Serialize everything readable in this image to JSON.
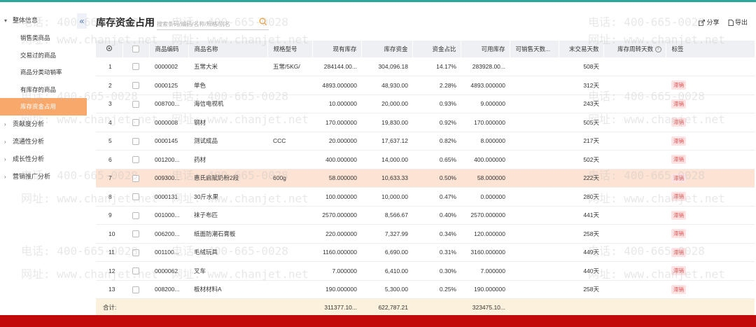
{
  "sidebar": {
    "groups": [
      {
        "label": "整体信息",
        "caret": "▾"
      },
      {
        "label": "贡献度分析",
        "caret": "›"
      },
      {
        "label": "流通性分析",
        "caret": "›"
      },
      {
        "label": "成长性分析",
        "caret": "›"
      },
      {
        "label": "营销推广分析",
        "caret": "›"
      }
    ],
    "subitems": [
      "销售类商品",
      "交易过的商品",
      "商品分类动销率",
      "有库存的商品",
      "库存资金占用"
    ],
    "collapse": "«"
  },
  "page_title": "库存资金占用",
  "search": {
    "placeholder": "搜索条码/编码/名称/规格/别名"
  },
  "toolbar": {
    "share": "分享",
    "export": "导出"
  },
  "table": {
    "headers": [
      "商品编码",
      "商品名称",
      "规格型号",
      "现有库存",
      "库存资金",
      "资金占比",
      "可用库存",
      "可销售天数...",
      "末交易天数",
      "库存周转天数",
      "标签"
    ],
    "rows": [
      {
        "no": "1",
        "code": "0000002",
        "name": "五常大米",
        "spec": "五常/5KG/",
        "stock": "284144.00...",
        "fund": "304,096.18",
        "ratio": "14.17%",
        "avail": "283928.00...",
        "sell": "",
        "last": "508天",
        "tag": ""
      },
      {
        "no": "2",
        "code": "0000125",
        "name": "单色",
        "spec": "",
        "stock": "4893.000000",
        "fund": "48,930.00",
        "ratio": "2.28%",
        "avail": "4893.000000",
        "sell": "",
        "last": "312天",
        "tag": "滞销"
      },
      {
        "no": "3",
        "code": "008700...",
        "name": "海信电视机",
        "spec": "",
        "stock": "10.000000",
        "fund": "20,000.00",
        "ratio": "0.93%",
        "avail": "9.000000",
        "sell": "",
        "last": "243天",
        "tag": "滞销"
      },
      {
        "no": "4",
        "code": "0000008",
        "name": "钢材",
        "spec": "",
        "stock": "170.000000",
        "fund": "19,830.00",
        "ratio": "0.92%",
        "avail": "170.000000",
        "sell": "",
        "last": "505天",
        "tag": "滞销"
      },
      {
        "no": "5",
        "code": "0000145",
        "name": "测试成品",
        "spec": "CCC",
        "stock": "20.000000",
        "fund": "17,637.12",
        "ratio": "0.82%",
        "avail": "8.000000",
        "sell": "",
        "last": "217天",
        "tag": "滞销"
      },
      {
        "no": "6",
        "code": "001200...",
        "name": "药材",
        "spec": "",
        "stock": "400.000000",
        "fund": "14,000.00",
        "ratio": "0.65%",
        "avail": "400.000000",
        "sell": "",
        "last": "502天",
        "tag": "滞销"
      },
      {
        "no": "7",
        "code": "009300...",
        "name": "惠氏启赋奶粉2段",
        "spec": "600g",
        "stock": "58.000000",
        "fund": "10,633.33",
        "ratio": "0.50%",
        "avail": "58.000000",
        "sell": "",
        "last": "222天",
        "tag": "滞销"
      },
      {
        "no": "8",
        "code": "0000131",
        "name": "30斤水果",
        "spec": "",
        "stock": "100.000000",
        "fund": "10,000.00",
        "ratio": "0.47%",
        "avail": "0.000000",
        "sell": "",
        "last": "280天",
        "tag": "滞销"
      },
      {
        "no": "9",
        "code": "001000...",
        "name": "袜子布匹",
        "spec": "",
        "stock": "2570.000000",
        "fund": "8,566.67",
        "ratio": "0.40%",
        "avail": "2570.000000",
        "sell": "",
        "last": "441天",
        "tag": "滞销"
      },
      {
        "no": "10",
        "code": "006200...",
        "name": "纸面防潮石膏板",
        "spec": "",
        "stock": "220.000000",
        "fund": "7,327.99",
        "ratio": "0.34%",
        "avail": "120.000000",
        "sell": "",
        "last": "258天",
        "tag": "滞销"
      },
      {
        "no": "11",
        "code": "001100...",
        "name": "毛绒玩具",
        "spec": "",
        "stock": "1160.000000",
        "fund": "6,690.00",
        "ratio": "0.31%",
        "avail": "3160.000000",
        "sell": "",
        "last": "449天",
        "tag": "滞销"
      },
      {
        "no": "12",
        "code": "0000062",
        "name": "叉车",
        "spec": "",
        "stock": "7.000000",
        "fund": "6,410.00",
        "ratio": "0.30%",
        "avail": "7.000000",
        "sell": "",
        "last": "440天",
        "tag": "滞销"
      },
      {
        "no": "13",
        "code": "008200...",
        "name": "板材材料A",
        "spec": "",
        "stock": "190.000000",
        "fund": "5,300.00",
        "ratio": "0.25%",
        "avail": "190.000000",
        "sell": "",
        "last": "258天",
        "tag": "滞销"
      }
    ],
    "footer": {
      "label": "合计:",
      "stock": "311377.10...",
      "fund": "622,787.21",
      "avail": "323475.10..."
    }
  },
  "watermark": {
    "phone": "电话: 400-665-0028",
    "site": "网址: www.chanjet.net"
  },
  "colors": {
    "accent": "#2aa99a",
    "active": "#f7a86a",
    "footer": "#c20a0a",
    "tag_bg": "#fde3e3",
    "tag_fg": "#e04e4e"
  }
}
